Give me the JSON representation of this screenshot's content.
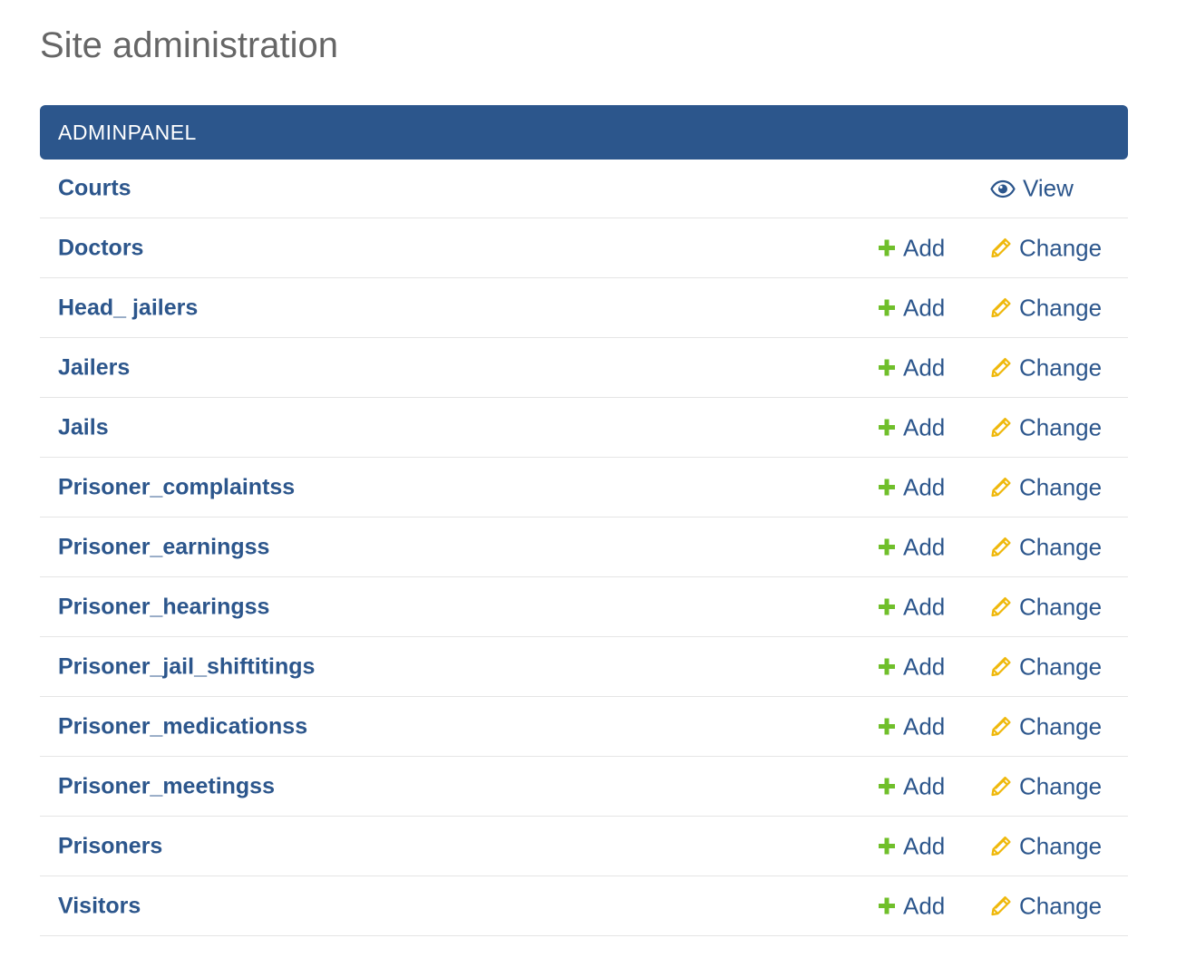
{
  "page": {
    "title": "Site administration"
  },
  "module": {
    "caption": "ADMINPANEL",
    "models": [
      {
        "name": "Courts",
        "actions": [
          "view"
        ]
      },
      {
        "name": "Doctors",
        "actions": [
          "add",
          "change"
        ]
      },
      {
        "name": "Head_ jailers",
        "actions": [
          "add",
          "change"
        ]
      },
      {
        "name": "Jailers",
        "actions": [
          "add",
          "change"
        ]
      },
      {
        "name": "Jails",
        "actions": [
          "add",
          "change"
        ]
      },
      {
        "name": "Prisoner_complaintss",
        "actions": [
          "add",
          "change"
        ]
      },
      {
        "name": "Prisoner_earningss",
        "actions": [
          "add",
          "change"
        ]
      },
      {
        "name": "Prisoner_hearingss",
        "actions": [
          "add",
          "change"
        ]
      },
      {
        "name": "Prisoner_jail_shiftitings",
        "actions": [
          "add",
          "change"
        ]
      },
      {
        "name": "Prisoner_medicationss",
        "actions": [
          "add",
          "change"
        ]
      },
      {
        "name": "Prisoner_meetingss",
        "actions": [
          "add",
          "change"
        ]
      },
      {
        "name": "Prisoners",
        "actions": [
          "add",
          "change"
        ]
      },
      {
        "name": "Visitors",
        "actions": [
          "add",
          "change"
        ]
      }
    ]
  },
  "labels": {
    "add": "Add",
    "change": "Change",
    "view": "View"
  },
  "icons": {
    "add": "plus-icon",
    "change": "pencil-icon",
    "view": "eye-icon"
  },
  "colors": {
    "caption_bg": "#2c568c",
    "link": "#2c568c",
    "add_icon": "#70bf2b",
    "change_icon": "#efb80b",
    "view_icon": "#2c568c"
  }
}
